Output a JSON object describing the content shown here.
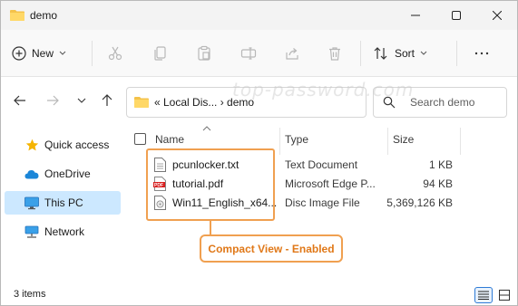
{
  "window": {
    "title": "demo",
    "controls": [
      "minimize-icon",
      "maximize-icon",
      "close-icon"
    ]
  },
  "toolbar": {
    "new_label": "New",
    "sort_label": "Sort",
    "icons": [
      "cut-icon",
      "copy-icon",
      "paste-icon",
      "rename-icon",
      "share-icon",
      "delete-icon"
    ]
  },
  "address": {
    "path_text": "«  Local Dis...  ›   demo",
    "search_placeholder": "Search demo",
    "watermark": "top-password.com"
  },
  "sidebar": {
    "items": [
      {
        "label": "Quick access",
        "icon": "star-icon"
      },
      {
        "label": "OneDrive",
        "icon": "cloud-icon"
      },
      {
        "label": "This PC",
        "icon": "monitor-icon",
        "selected": true
      },
      {
        "label": "Network",
        "icon": "network-icon"
      }
    ]
  },
  "columns": {
    "name": "Name",
    "type": "Type",
    "size": "Size"
  },
  "files": [
    {
      "name": "pcunlocker.txt",
      "type": "Text Document",
      "size": "1 KB",
      "icon": "text-file-icon"
    },
    {
      "name": "tutorial.pdf",
      "type": "Microsoft Edge P...",
      "size": "94 KB",
      "icon": "pdf-file-icon"
    },
    {
      "name": "Win11_English_x64...",
      "type": "Disc Image File",
      "size": "5,369,126 KB",
      "icon": "disc-image-icon"
    }
  ],
  "callout": {
    "text": "Compact View - Enabled"
  },
  "status": {
    "items_text": "3 items"
  },
  "colors": {
    "accent": "#0067c0",
    "highlight_orange": "#f0a050",
    "callout_text": "#e07818",
    "selected_bg": "#cce8ff"
  }
}
